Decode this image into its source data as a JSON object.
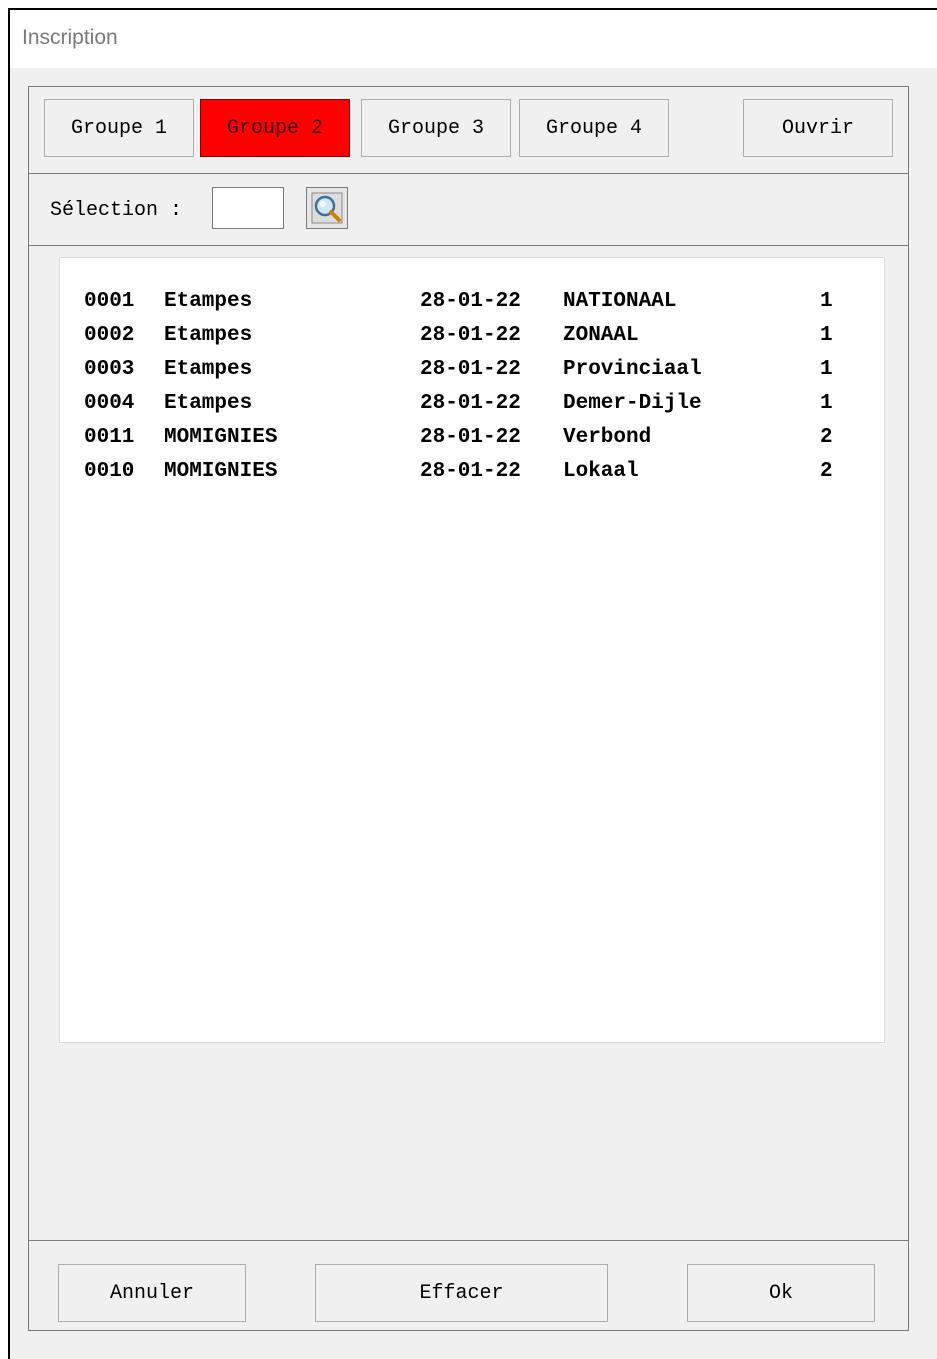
{
  "window": {
    "title": "Inscription"
  },
  "groups": [
    {
      "label": "Groupe 1",
      "active": false
    },
    {
      "label": "Groupe 2",
      "active": true
    },
    {
      "label": "Groupe 3",
      "active": false
    },
    {
      "label": "Groupe 4",
      "active": false
    }
  ],
  "toolbar": {
    "open_label": "Ouvrir"
  },
  "selection": {
    "label": "Sélection :",
    "value": "",
    "search_icon": "magnifier-search-icon"
  },
  "list": {
    "rows": [
      {
        "id": "0001",
        "name": "Etampes",
        "date": "28-01-22",
        "region": "NATIONAAL",
        "num": "1"
      },
      {
        "id": "0002",
        "name": "Etampes",
        "date": "28-01-22",
        "region": "ZONAAL",
        "num": "1"
      },
      {
        "id": "0003",
        "name": "Etampes",
        "date": "28-01-22",
        "region": "Provinciaal",
        "num": "1"
      },
      {
        "id": "0004",
        "name": "Etampes",
        "date": "28-01-22",
        "region": "Demer-Dijle",
        "num": "1"
      },
      {
        "id": "0011",
        "name": "MOMIGNIES",
        "date": "28-01-22",
        "region": "Verbond",
        "num": "2"
      },
      {
        "id": "0010",
        "name": "MOMIGNIES",
        "date": "28-01-22",
        "region": "Lokaal",
        "num": "2"
      }
    ]
  },
  "footer": {
    "cancel_label": "Annuler",
    "clear_label": "Effacer",
    "ok_label": "Ok"
  },
  "colors": {
    "active_group": "#ff0000",
    "background": "#f0f0f0",
    "border": "#7a7a7a"
  }
}
